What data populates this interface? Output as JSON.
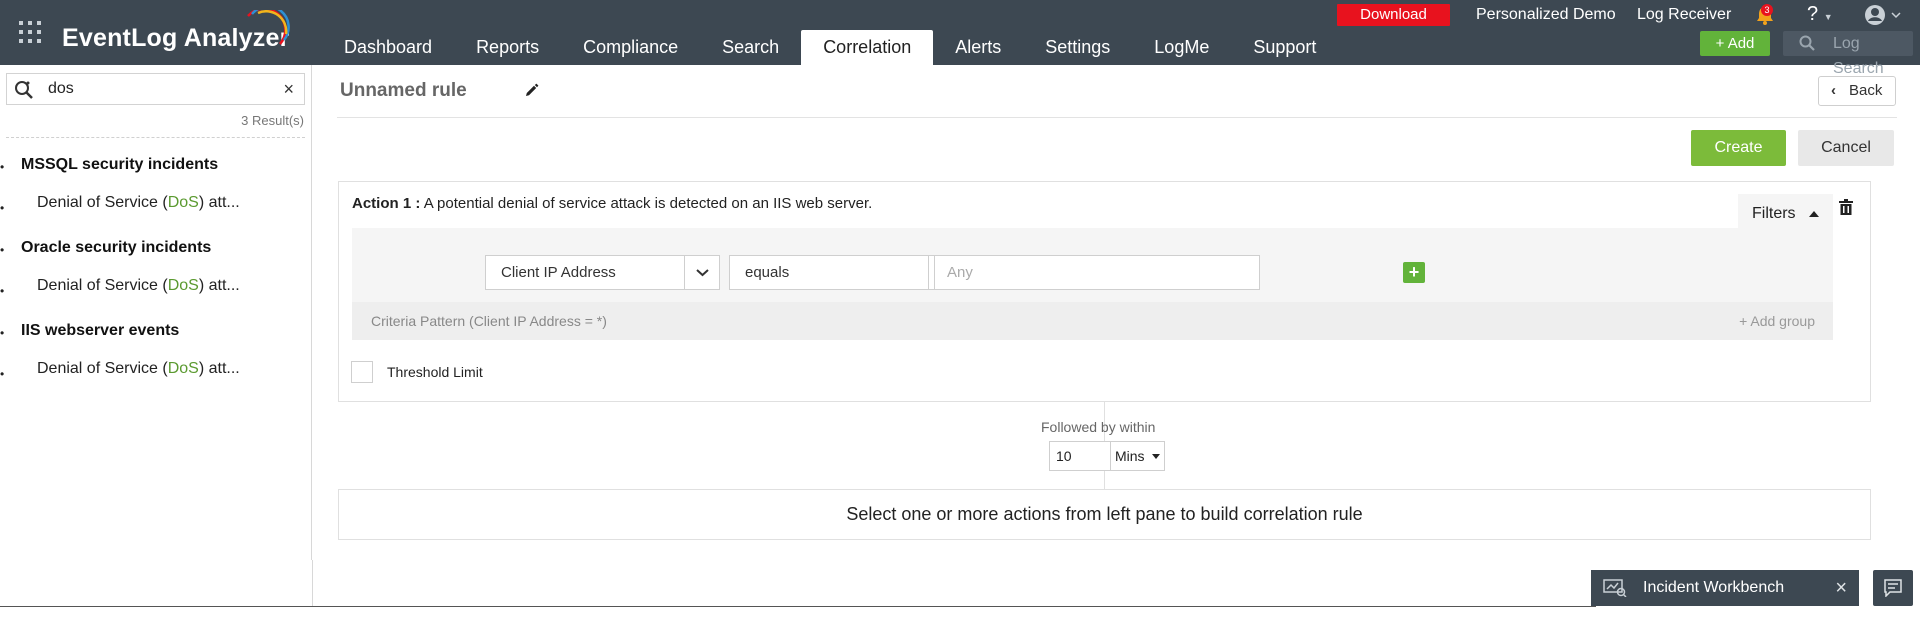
{
  "app": {
    "brand": "EventLog Analyzer"
  },
  "topbar": {
    "download_label": "Download",
    "personalized_demo": "Personalized Demo",
    "log_receiver": "Log Receiver",
    "notification_count": "3",
    "help_label": "?",
    "add_label": "+ Add",
    "log_search_placeholder": "Log Search",
    "nav": [
      {
        "label": "Dashboard"
      },
      {
        "label": "Reports"
      },
      {
        "label": "Compliance"
      },
      {
        "label": "Search"
      },
      {
        "label": "Correlation",
        "active": true
      },
      {
        "label": "Alerts"
      },
      {
        "label": "Settings"
      },
      {
        "label": "LogMe"
      },
      {
        "label": "Support"
      }
    ]
  },
  "left_pane": {
    "search_value": "dos",
    "clear_label": "×",
    "results_count": "3 Result(s)",
    "groups": [
      {
        "title": "MSSQL security incidents",
        "item_prefix": "Denial of Service (",
        "item_match": "DoS",
        "item_suffix": ") att..."
      },
      {
        "title": "Oracle security incidents",
        "item_prefix": "Denial of Service (",
        "item_match": "DoS",
        "item_suffix": ") att..."
      },
      {
        "title": "IIS webserver events",
        "item_prefix": "Denial of Service (",
        "item_match": "DoS",
        "item_suffix": ") att..."
      }
    ]
  },
  "main": {
    "rule_title": "Unnamed rule",
    "back_label": "Back",
    "create_label": "Create",
    "cancel_label": "Cancel",
    "action": {
      "label": "Action 1 :",
      "description": "A potential denial of service attack is detected on an IIS web server.",
      "filters_label": "Filters",
      "field_select": "Client IP Address",
      "operator_select": "equals",
      "value_placeholder": "Any",
      "criteria_pattern": "Criteria Pattern (Client IP Address = *)",
      "add_group_label": "+ Add group",
      "threshold_label": "Threshold Limit"
    },
    "followed_by_label": "Followed by within",
    "followed_value": "10",
    "followed_unit": "Mins",
    "hint": "Select one or more actions from left pane to build correlation rule"
  },
  "bottom": {
    "incident_workbench": "Incident Workbench",
    "close_label": "×"
  },
  "colors": {
    "topbar": "#3d4852",
    "accent_green": "#7cbb3a",
    "download_red": "#e8121e",
    "match_green": "#5b9a30"
  },
  "icons": [
    "apps-grid-icon",
    "bell-icon",
    "help-icon",
    "user-icon",
    "search-icon",
    "pencil-icon",
    "chevron-left-icon",
    "chevron-up-icon",
    "trash-icon",
    "chevron-down-icon",
    "plus-icon",
    "workbench-icon",
    "close-icon",
    "chat-icon"
  ]
}
